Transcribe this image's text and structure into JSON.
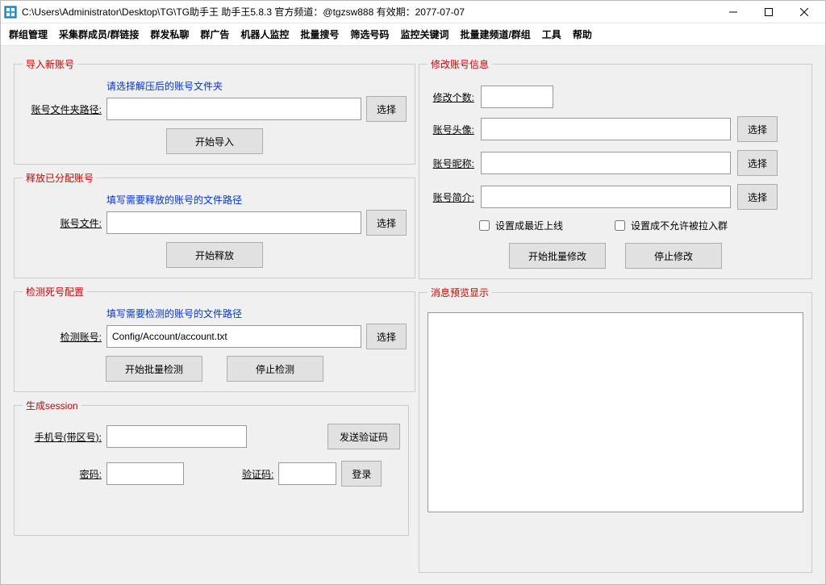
{
  "window": {
    "title": "C:\\Users\\Administrator\\Desktop\\TG\\TG助手王   助手王5.8.3   官方频道：@tgzsw888      有效期：2077-07-07"
  },
  "menu": {
    "items": [
      "群组管理",
      "采集群成员/群链接",
      "群发私聊",
      "群广告",
      "机器人监控",
      "批量搜号",
      "筛选号码",
      "监控关键词",
      "批量建频道/群组",
      "工具",
      "帮助"
    ]
  },
  "left": {
    "import": {
      "legend": "导入新账号",
      "hint": "请选择解压后的账号文件夹",
      "label": "账号文件夹路径:",
      "choose": "选择",
      "start": "开始导入"
    },
    "release": {
      "legend": "释放已分配账号",
      "hint": "填写需要释放的账号的文件路径",
      "label": "账号文件:",
      "choose": "选择",
      "start": "开始释放"
    },
    "detect": {
      "legend": "检测死号配置",
      "hint": "填写需要检测的账号的文件路径",
      "label": "检测账号:",
      "value": "Config/Account/account.txt",
      "choose": "选择",
      "start": "开始批量检测",
      "stop": "停止检测"
    },
    "session": {
      "legend": "生成session",
      "phone_label": "手机号(带区号):",
      "send_code": "发送验证码",
      "password_label": "密码:",
      "code_label": "验证码:",
      "login": "登录"
    }
  },
  "right": {
    "modify": {
      "legend": "修改账号信息",
      "count_label": "修改个数:",
      "avatar_label": "账号头像:",
      "nick_label": "账号昵称:",
      "bio_label": "账号简介:",
      "choose": "选择",
      "check1": "设置成最近上线",
      "check2": "设置成不允许被拉入群",
      "start": "开始批量修改",
      "stop": "停止修改"
    },
    "preview": {
      "legend": "消息预览显示"
    }
  }
}
